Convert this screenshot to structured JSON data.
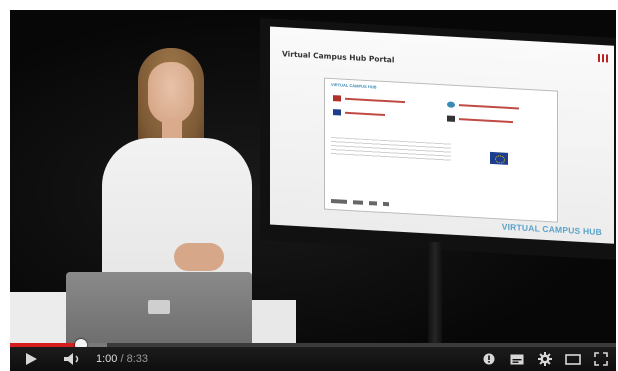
{
  "player": {
    "current_time": "1:00",
    "separator": "/",
    "duration": "8:33",
    "played_fraction": 0.117,
    "loaded_fraction": 0.16
  },
  "slide": {
    "title": "Virtual Campus Hub Portal",
    "brand": "VIRTUAL CAMPUS HUB"
  },
  "controls": {
    "play_icon": "play-icon",
    "volume_icon": "volume-icon",
    "annotations_icon": "annotations-icon",
    "captions_icon": "captions-icon",
    "settings_icon": "gear-icon",
    "theater_icon": "theater-mode-icon",
    "fullscreen_icon": "fullscreen-icon"
  },
  "colors": {
    "progress_played": "#d31f1f",
    "progress_loaded": "#7a7a7a",
    "brand": "#5aa3c8"
  }
}
